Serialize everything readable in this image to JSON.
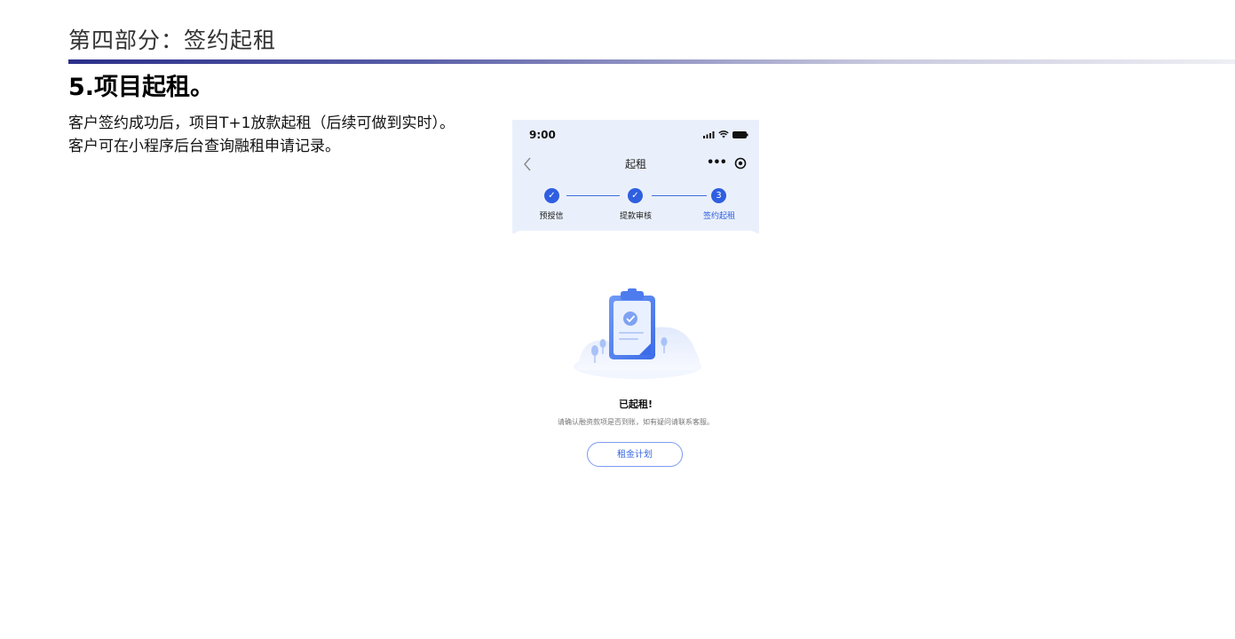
{
  "section_title": "第四部分：签约起租",
  "heading": "5.项目起租。",
  "body": [
    "客户签约成功后，项目T+1放款起租（后续可做到实时）。",
    "客户可在小程序后台查询融租申请记录。"
  ],
  "phone": {
    "status_time": "9:00",
    "nav_title": "起租",
    "nav_more": "•••",
    "steps": [
      {
        "label": "预授信",
        "mark": "✓",
        "state": "done"
      },
      {
        "label": "提款审核",
        "mark": "✓",
        "state": "done"
      },
      {
        "label": "签约起租",
        "mark": "3",
        "state": "current"
      }
    ],
    "done_title": "已起租!",
    "done_desc": "请确认融资款项是否到账，如有疑问请联系客服。",
    "plan_button": "租金计划"
  },
  "colors": {
    "accent": "#2f5fe0",
    "rule_dark": "#2b2f8a",
    "phone_bg": "#eaf0fb"
  }
}
